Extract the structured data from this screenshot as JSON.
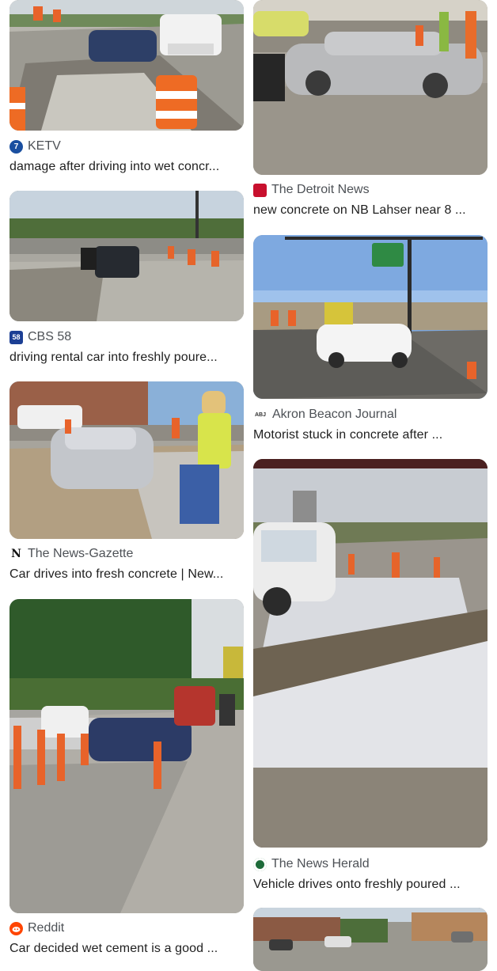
{
  "results": [
    {
      "source": "KETV",
      "title": "damage after driving into wet concr...",
      "favicon": "ketv-logo-icon",
      "favicon_color": "#1a4fa0",
      "favicon_text": "7"
    },
    {
      "source": "The Detroit News",
      "title": "new concrete on NB Lahser near 8 ...",
      "favicon": "detroit-news-logo-icon",
      "favicon_color": "#c8102e",
      "favicon_text": ""
    },
    {
      "source": "CBS 58",
      "title": "driving rental car into freshly poure...",
      "favicon": "cbs58-logo-icon",
      "favicon_color": "#1c3f94",
      "favicon_text": "58"
    },
    {
      "source": "Akron Beacon Journal",
      "title": "Motorist stuck in concrete after ...",
      "favicon": "abj-logo-icon",
      "favicon_color": "#ffffff",
      "favicon_text": "ABJ"
    },
    {
      "source": "The News-Gazette",
      "title": "Car drives into fresh concrete | New...",
      "favicon": "news-gazette-logo-icon",
      "favicon_color": "#ffffff",
      "favicon_text": "N"
    },
    {
      "source": "The News Herald",
      "title": "Vehicle drives onto freshly poured ...",
      "favicon": "news-herald-logo-icon",
      "favicon_color": "#1e6b3a",
      "favicon_text": ""
    },
    {
      "source": "Reddit",
      "title": "Car decided wet cement is a good ...",
      "favicon": "reddit-logo-icon",
      "favicon_color": "#ff4500",
      "favicon_text": ""
    }
  ]
}
